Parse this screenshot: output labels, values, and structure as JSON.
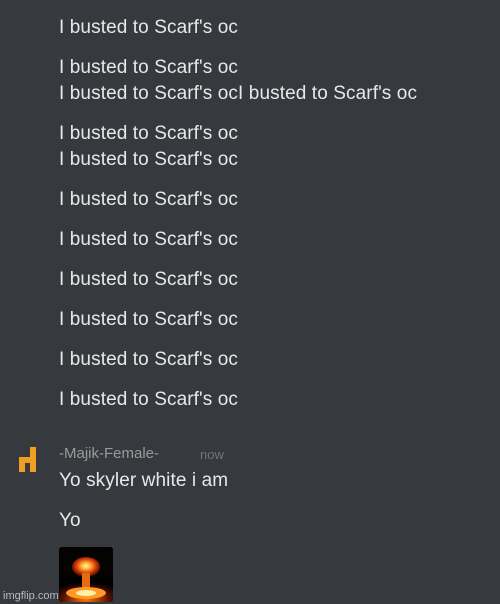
{
  "messages": [
    "I busted to Scarf's oc",
    "I busted to Scarf's oc",
    "I busted to Scarf's ocI busted to Scarf's oc",
    "I busted to Scarf's oc",
    "I busted to Scarf's oc",
    "I busted to Scarf's oc",
    "I busted to Scarf's oc",
    "I busted to Scarf's oc",
    "I busted to Scarf's oc",
    "I busted to Scarf's oc",
    "I busted to Scarf's oc"
  ],
  "post": {
    "username": "-Majik-Female-",
    "timestamp": "now",
    "lines": [
      "Yo skyler white i am",
      "Yo"
    ],
    "attachment_icon": "nuclear-explosion-image"
  },
  "avatar": {
    "icon": "orange-glyph-avatar",
    "color": "#f0a020"
  },
  "watermark": "imgflip.com",
  "colors": {
    "background": "#36393e",
    "text": "#e8e8e8",
    "username": "#9a9a9a",
    "timestamp": "#70757b"
  }
}
